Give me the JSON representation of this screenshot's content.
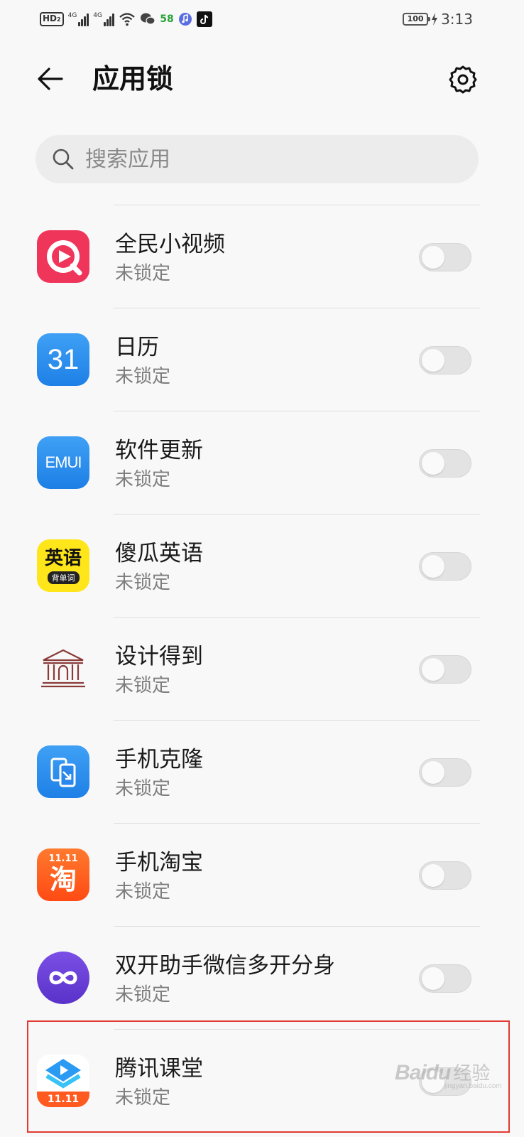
{
  "status_bar": {
    "hd_label": "HD",
    "hd_sub": "2",
    "net1_label": "4G",
    "net2_label": "4G",
    "app58_label": "58",
    "battery_text": "100",
    "time": "3:13"
  },
  "header": {
    "title": "应用锁"
  },
  "search": {
    "placeholder": "搜索应用"
  },
  "apps": [
    {
      "name": "全民小视频",
      "status": "未锁定",
      "locked": false,
      "icon": "quanmin-video-icon"
    },
    {
      "name": "日历",
      "status": "未锁定",
      "locked": false,
      "icon": "calendar-icon",
      "icon_text": "31"
    },
    {
      "name": "软件更新",
      "status": "未锁定",
      "locked": false,
      "icon": "emui-update-icon",
      "icon_text": "EMUI"
    },
    {
      "name": "傻瓜英语",
      "status": "未锁定",
      "locked": false,
      "icon": "shagua-english-icon",
      "icon_text": "英语",
      "icon_subtext": "背单词"
    },
    {
      "name": "设计得到",
      "status": "未锁定",
      "locked": false,
      "icon": "museum-building-icon"
    },
    {
      "name": "手机克隆",
      "status": "未锁定",
      "locked": false,
      "icon": "phone-clone-icon"
    },
    {
      "name": "手机淘宝",
      "status": "未锁定",
      "locked": false,
      "icon": "taobao-icon",
      "icon_text": "淘",
      "icon_subtext": "11.11"
    },
    {
      "name": "双开助手微信多开分身",
      "status": "未锁定",
      "locked": false,
      "icon": "dual-app-icon"
    },
    {
      "name": "腾讯课堂",
      "status": "未锁定",
      "locked": false,
      "icon": "tencent-classroom-icon",
      "icon_subtext": "11.11"
    }
  ],
  "watermark": {
    "logo": "Baidu",
    "cn": "经验",
    "url": "jingyan.baidu.com"
  },
  "colors": {
    "background": "#f8f8f8",
    "toggle_off": "#e3e3e3",
    "highlight": "#e23a32",
    "calendar_blue": "#2f8ff0",
    "taobao_orange": "#ff5a1f",
    "dual_purple": "#6a3fd9",
    "quanmin_red": "#f0355a"
  }
}
